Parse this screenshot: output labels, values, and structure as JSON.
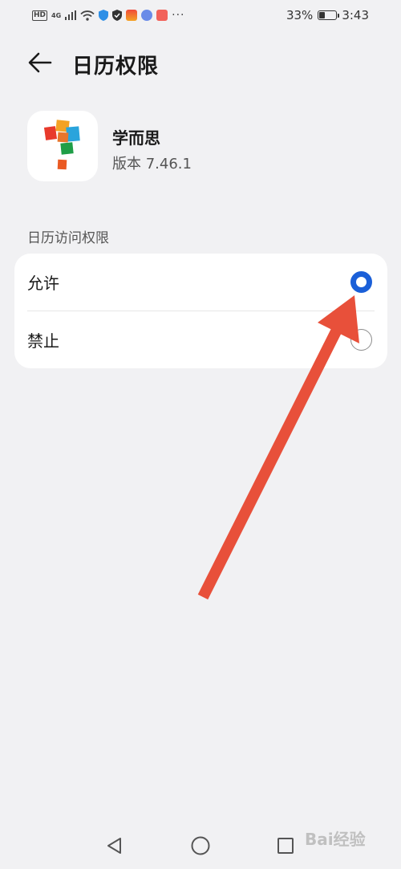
{
  "status_bar": {
    "network_badge": "HD",
    "network_type": "4G",
    "battery_percent": "33%",
    "battery_level": 0.33,
    "time": "3:43",
    "more": "···"
  },
  "header": {
    "title": "日历权限",
    "back_icon": "arrow-left-icon"
  },
  "app": {
    "name": "学而思",
    "version": "版本 7.46.1"
  },
  "section": {
    "label": "日历访问权限"
  },
  "options": [
    {
      "label": "允许",
      "selected": true
    },
    {
      "label": "禁止",
      "selected": false
    }
  ],
  "colors": {
    "accent": "#1a5fd8",
    "background": "#f1f1f3",
    "card": "#ffffff",
    "annotation_arrow": "#e8503a"
  },
  "nav_bar": {
    "back_icon": "triangle-back-icon",
    "home_icon": "circle-home-icon",
    "recent_icon": "square-recent-icon"
  },
  "watermark": {
    "text": "Bai经验"
  }
}
